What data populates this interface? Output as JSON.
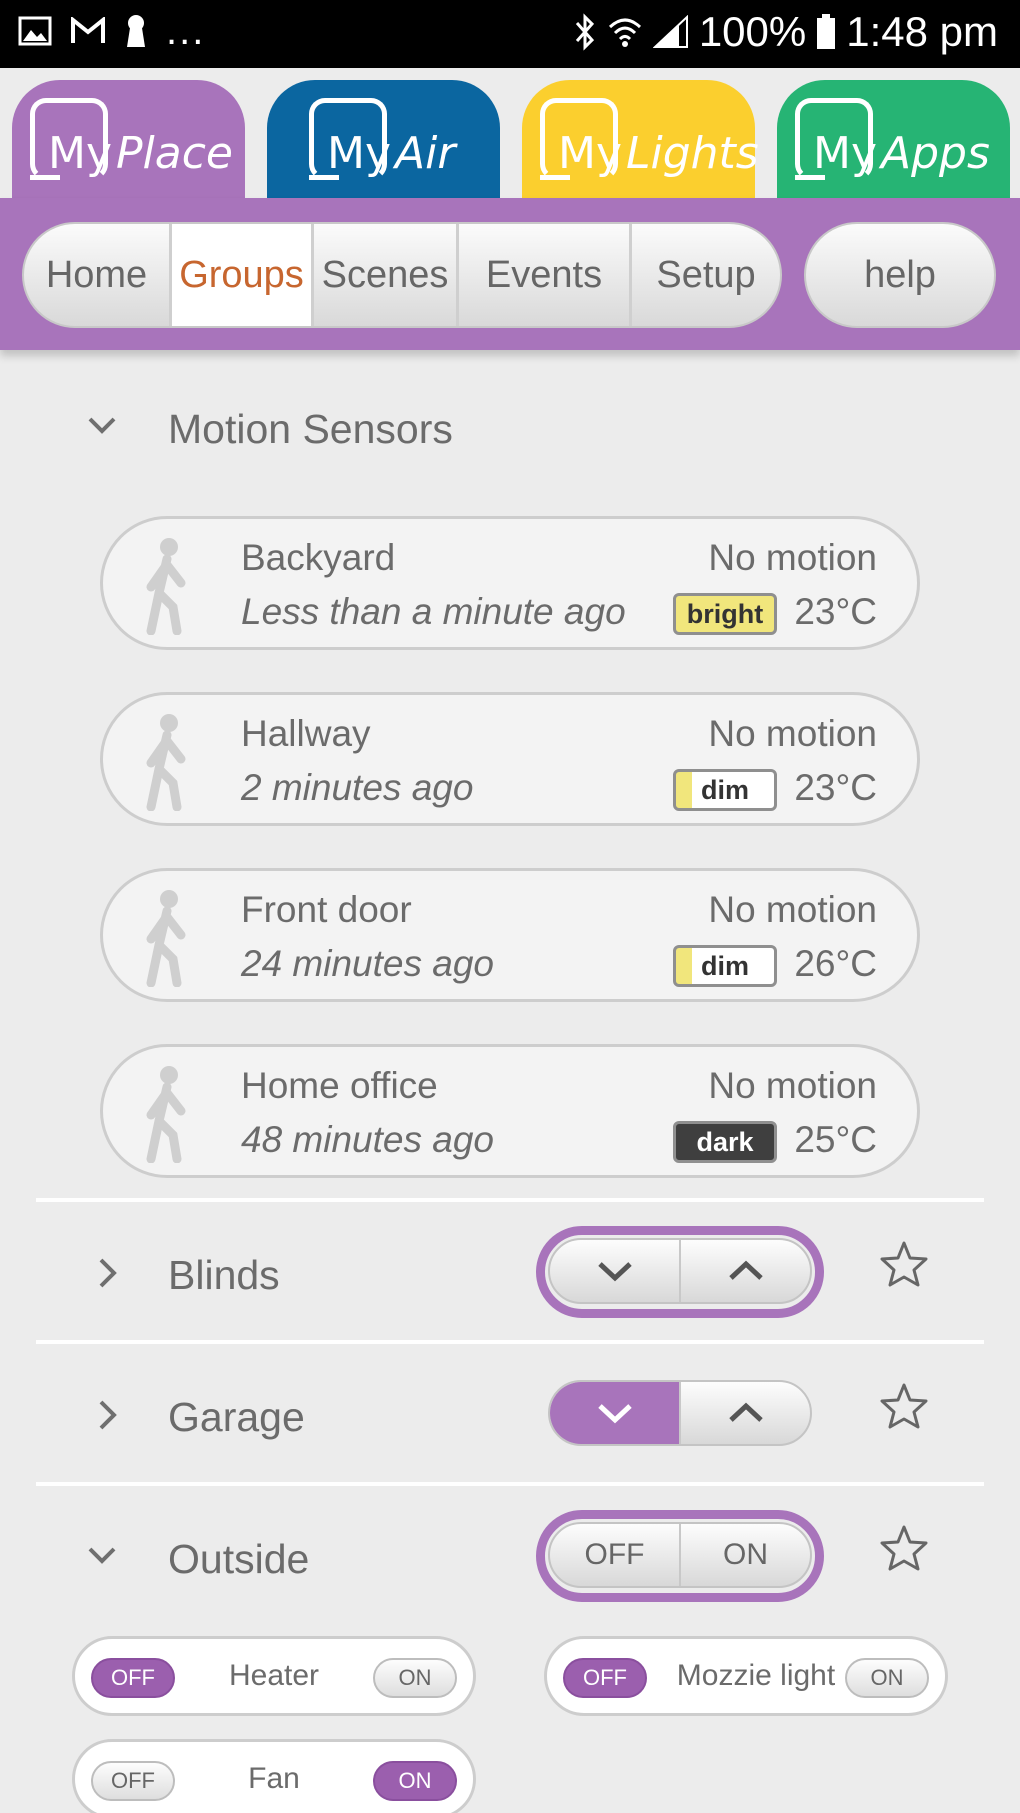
{
  "status_bar": {
    "battery": "100%",
    "time": "1:48 pm",
    "more": "..."
  },
  "app_tabs": [
    {
      "prefix": "My",
      "name": "Place",
      "color": "#a874bb"
    },
    {
      "prefix": "My",
      "name": "Air",
      "color": "#0b66a0"
    },
    {
      "prefix": "My",
      "name": "Lights",
      "color": "#fbcf2e"
    },
    {
      "prefix": "My",
      "name": "Apps",
      "color": "#26b474"
    }
  ],
  "nav": {
    "items": [
      "Home",
      "Groups",
      "Scenes",
      "Events",
      "Setup"
    ],
    "active": "Groups",
    "help": "help"
  },
  "motion_section": {
    "title": "Motion Sensors"
  },
  "sensors": [
    {
      "name": "Backyard",
      "ago": "Less than a minute ago",
      "motion": "No motion",
      "light": "bright",
      "temp": "23°C"
    },
    {
      "name": "Hallway",
      "ago": "2 minutes ago",
      "motion": "No motion",
      "light": "dim",
      "temp": "23°C"
    },
    {
      "name": "Front door",
      "ago": "24 minutes ago",
      "motion": "No motion",
      "light": "dim",
      "temp": "26°C"
    },
    {
      "name": "Home office",
      "ago": "48 minutes ago",
      "motion": "No motion",
      "light": "dark",
      "temp": "25°C"
    }
  ],
  "blinds": {
    "title": "Blinds",
    "down": "⌄",
    "up": "⌃"
  },
  "garage": {
    "title": "Garage",
    "down": "⌄",
    "up": "⌃"
  },
  "outside": {
    "title": "Outside",
    "off": "OFF",
    "on": "ON"
  },
  "switches": [
    {
      "name": "Heater",
      "off": "OFF",
      "on": "ON",
      "state": "off"
    },
    {
      "name": "Mozzie light",
      "off": "OFF",
      "on": "ON",
      "state": "off"
    },
    {
      "name": "Fan",
      "off": "OFF",
      "on": "ON",
      "state": "on"
    }
  ],
  "icons": {
    "collapse": "chevron-down-icon",
    "expand": "chevron-right-icon",
    "favorite": "star-icon",
    "sensor": "walking-person-icon"
  }
}
